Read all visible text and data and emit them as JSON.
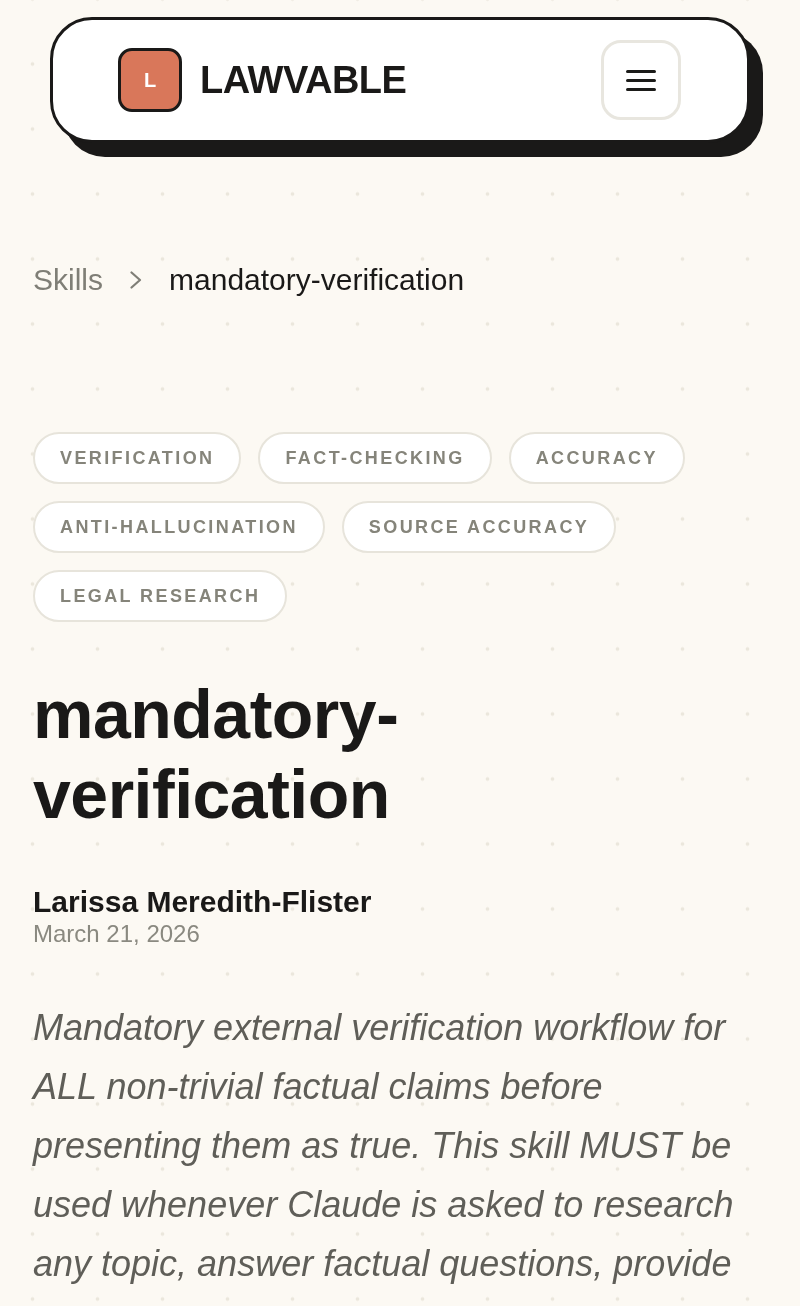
{
  "header": {
    "logo_letter": "L",
    "brand": "LAWVABLE"
  },
  "breadcrumb": [
    {
      "label": "Skills",
      "current": false
    },
    {
      "label": "mandatory-verification",
      "current": true
    }
  ],
  "tags": [
    "VERIFICATION",
    "FACT-CHECKING",
    "ACCURACY",
    "ANTI-HALLUCINATION",
    "SOURCE ACCURACY",
    "LEGAL RESEARCH"
  ],
  "title": "mandatory-verification",
  "author": "Larissa Meredith-Flister",
  "date": "March 21, 2026",
  "description": "Mandatory external verification workflow for ALL non-trivial factual claims before presenting them as true. This skill MUST be used whenever Claude is asked to research any topic, answer factual questions, provide"
}
